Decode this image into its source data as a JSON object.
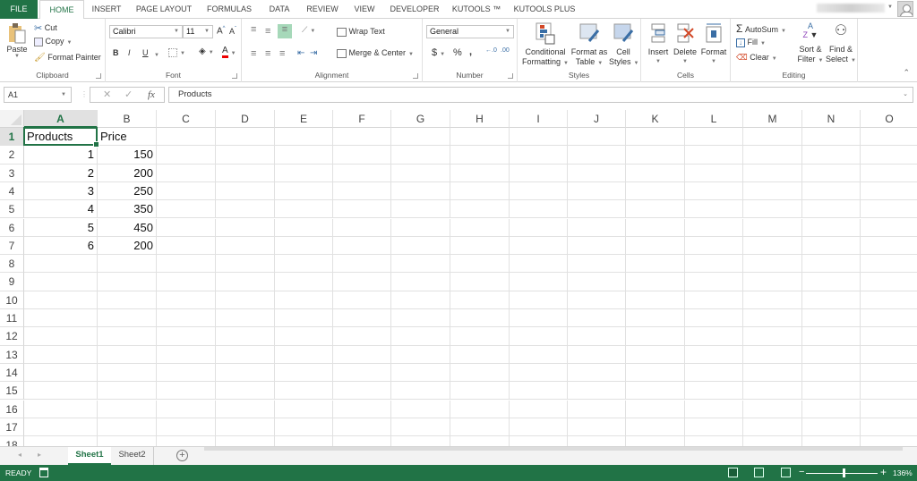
{
  "ribbon_tabs": [
    "FILE",
    "HOME",
    "INSERT",
    "PAGE LAYOUT",
    "FORMULAS",
    "DATA",
    "REVIEW",
    "VIEW",
    "DEVELOPER",
    "KUTOOLS ™",
    "KUTOOLS PLUS"
  ],
  "active_tab": "HOME",
  "clipboard": {
    "paste": "Paste",
    "cut": "Cut",
    "copy": "Copy",
    "format_painter": "Format Painter",
    "label": "Clipboard"
  },
  "font": {
    "name": "Calibri",
    "size": "11",
    "bold": "B",
    "italic": "I",
    "underline": "U",
    "label": "Font"
  },
  "alignment": {
    "wrap_text": "Wrap Text",
    "merge_center": "Merge & Center",
    "label": "Alignment"
  },
  "number": {
    "format": "General",
    "currency": "$",
    "percent": "%",
    "comma": ",",
    "label": "Number"
  },
  "styles": {
    "conditional": "Conditional",
    "conditional2": "Formatting",
    "format_as": "Format as",
    "format_as2": "Table",
    "cell": "Cell",
    "cell2": "Styles",
    "label": "Styles"
  },
  "cells": {
    "insert": "Insert",
    "delete": "Delete",
    "format": "Format",
    "label": "Cells"
  },
  "editing": {
    "autosum": "AutoSum",
    "fill": "Fill",
    "clear": "Clear",
    "sort1": "Sort &",
    "sort2": "Filter",
    "find1": "Find &",
    "find2": "Select",
    "label": "Editing"
  },
  "formula_bar": {
    "name_box": "A1",
    "fx": "fx",
    "content": "Products"
  },
  "columns": [
    "A",
    "B",
    "C",
    "D",
    "E",
    "F",
    "G",
    "H",
    "I",
    "J",
    "K",
    "L",
    "M",
    "N",
    "O"
  ],
  "rows": [
    "1",
    "2",
    "3",
    "4",
    "5",
    "6",
    "7",
    "8",
    "9",
    "10",
    "11",
    "12",
    "13",
    "14",
    "15",
    "16",
    "17",
    "18"
  ],
  "cells_data": {
    "A1": "Products",
    "B1": "Price",
    "A2": "1",
    "B2": "150",
    "A3": "2",
    "B3": "200",
    "A4": "3",
    "B4": "250",
    "A5": "4",
    "B5": "350",
    "A6": "5",
    "B6": "450",
    "A7": "6",
    "B7": "200"
  },
  "selected_cell": "A1",
  "sheets": [
    "Sheet1",
    "Sheet2"
  ],
  "active_sheet": "Sheet1",
  "status": {
    "mode": "READY",
    "zoom": "136%"
  },
  "colors": {
    "accent": "#217346"
  }
}
